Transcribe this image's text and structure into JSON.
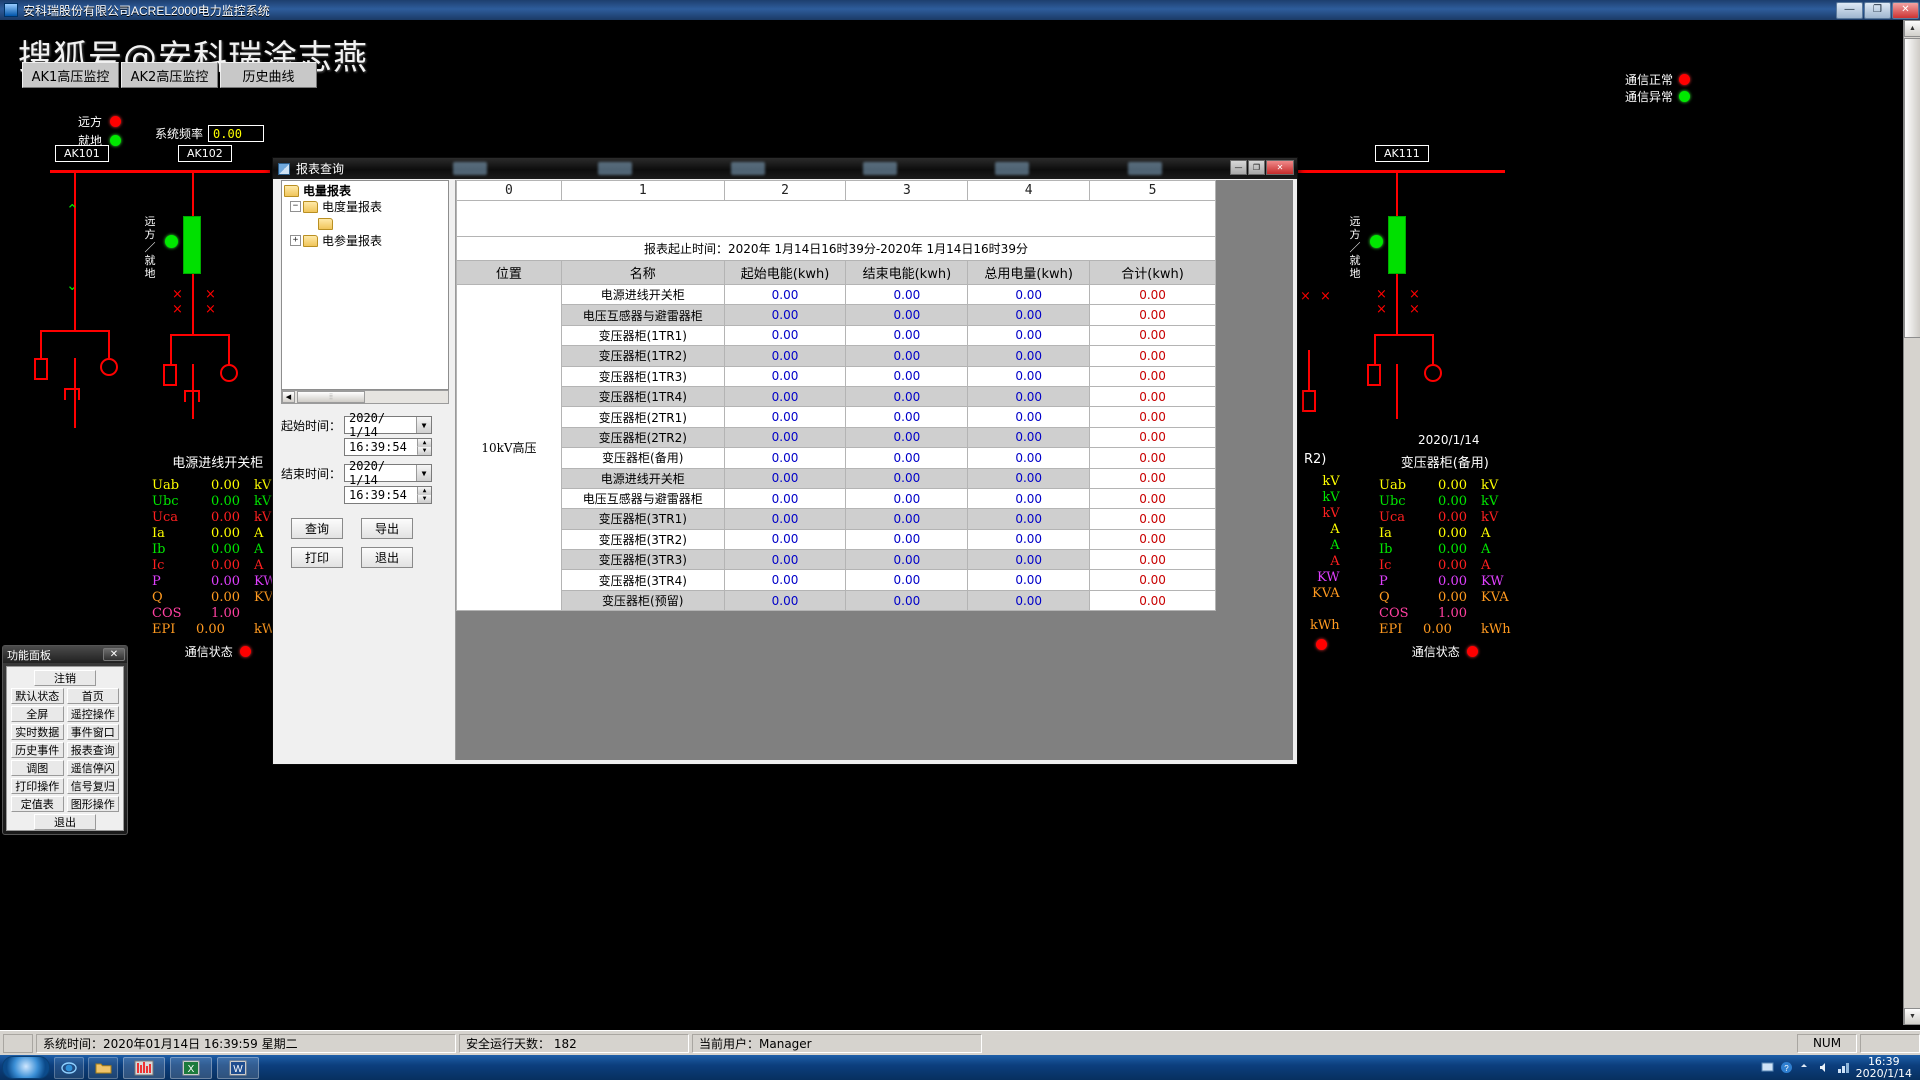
{
  "os": {
    "title": "安科瑞股份有限公司ACREL2000电力监控系统",
    "min": "—",
    "max": "❐",
    "close": "✕"
  },
  "watermark": "搜狐号@安科瑞涂志燕",
  "nav": [
    {
      "label": "AK1高压监控"
    },
    {
      "label": "AK2高压监控"
    },
    {
      "label": "历史曲线"
    }
  ],
  "comm_top": [
    {
      "label": "通信正常",
      "color": "#ff0000"
    },
    {
      "label": "通信异常",
      "color": "#00e800"
    }
  ],
  "remote_local": [
    {
      "label": "远方",
      "color": "#ff0000"
    },
    {
      "label": "就地",
      "color": "#00e800"
    }
  ],
  "frequency": {
    "label": "系统频率",
    "value": "0.00"
  },
  "bus_labels": {
    "ak101": "AK101",
    "ak102": "AK102",
    "ak111": "AK111"
  },
  "diagram_side_text": {
    "left": "远方／就地",
    "right": "远方／就地"
  },
  "panel_left": {
    "title": "电源进线开关柜",
    "rows": [
      {
        "name": "Uab",
        "value": "0.00",
        "unit": "kV",
        "color": "#ffff00"
      },
      {
        "name": "Ubc",
        "value": "0.00",
        "unit": "kV",
        "color": "#00e800"
      },
      {
        "name": "Uca",
        "value": "0.00",
        "unit": "kV",
        "color": "#ff2020"
      },
      {
        "name": "Ia",
        "value": "0.00",
        "unit": "A",
        "color": "#ffff00"
      },
      {
        "name": "Ib",
        "value": "0.00",
        "unit": "A",
        "color": "#00e800"
      },
      {
        "name": "Ic",
        "value": "0.00",
        "unit": "A",
        "color": "#ff2020"
      },
      {
        "name": "P",
        "value": "0.00",
        "unit": "KW",
        "color": "#e040ff"
      },
      {
        "name": "Q",
        "value": "0.00",
        "unit": "KVA",
        "color": "#ff9a20"
      },
      {
        "name": "COS",
        "value": "1.00",
        "unit": "",
        "color": "#ff40a0"
      },
      {
        "name": "EPI",
        "value": "0.00",
        "unit": "kWh",
        "color": "#ff9a20"
      }
    ],
    "comm_label": "通信状态"
  },
  "panel_right_partial": {
    "title": "R2)",
    "units": [
      "kV",
      "kV",
      "kV",
      "A",
      "A",
      "A",
      "KW",
      "KVA",
      "",
      "kWh"
    ],
    "colors": [
      "#ffff00",
      "#00e800",
      "#ff2020",
      "#ffff00",
      "#00e800",
      "#ff2020",
      "#e040ff",
      "#ff9a20",
      "#ff40a0",
      "#ff9a20"
    ]
  },
  "panel_right": {
    "title": "变压器柜(备用)",
    "rows": [
      {
        "name": "Uab",
        "value": "0.00",
        "unit": "kV",
        "color": "#ffff00"
      },
      {
        "name": "Ubc",
        "value": "0.00",
        "unit": "kV",
        "color": "#00e800"
      },
      {
        "name": "Uca",
        "value": "0.00",
        "unit": "kV",
        "color": "#ff2020"
      },
      {
        "name": "Ia",
        "value": "0.00",
        "unit": "A",
        "color": "#ffff00"
      },
      {
        "name": "Ib",
        "value": "0.00",
        "unit": "A",
        "color": "#00e800"
      },
      {
        "name": "Ic",
        "value": "0.00",
        "unit": "A",
        "color": "#ff2020"
      },
      {
        "name": "P",
        "value": "0.00",
        "unit": "KW",
        "color": "#e040ff"
      },
      {
        "name": "Q",
        "value": "0.00",
        "unit": "KVA",
        "color": "#ff9a20"
      },
      {
        "name": "COS",
        "value": "1.00",
        "unit": "",
        "color": "#ff40a0"
      },
      {
        "name": "EPI",
        "value": "0.00",
        "unit": "kWh",
        "color": "#ff9a20"
      }
    ],
    "comm_label": "通信状态",
    "date_stamp": "2020/1/14"
  },
  "func_panel": {
    "title": "功能面板",
    "close": "✕",
    "logout": "注销",
    "buttons": [
      [
        "默认状态",
        "首页"
      ],
      [
        "全屏",
        "遥控操作"
      ],
      [
        "实时数据",
        "事件窗口"
      ],
      [
        "历史事件",
        "报表查询"
      ],
      [
        "调图",
        "遥信停闪"
      ],
      [
        "打印操作",
        "信号复归"
      ],
      [
        "定值表",
        "图形操作"
      ]
    ],
    "exit": "退出"
  },
  "report": {
    "title": "报表查询",
    "min": "—",
    "max": "❐",
    "close": "✕",
    "tree": {
      "root": "电量报表",
      "children": [
        {
          "label": "电度量报表",
          "toggle": "−"
        },
        {
          "label": "",
          "toggle": ""
        },
        {
          "label": "电参量报表",
          "toggle": "+"
        }
      ]
    },
    "form": {
      "start_label": "起始时间：",
      "start_date": "2020/ 1/14",
      "start_time": "16:39:54",
      "end_label": "结束时间：",
      "end_date": "2020/ 1/14",
      "end_time": "16:39:54",
      "buttons": [
        "查询",
        "导出",
        "打印",
        "退出"
      ]
    },
    "column_index": [
      "0",
      "1",
      "2",
      "3",
      "4",
      "5"
    ],
    "time_range": "报表起止时间：2020年 1月14日16时39分-2020年 1月14日16时39分",
    "headers": [
      "位置",
      "名称",
      "起始电能(kwh)",
      "结束电能(kwh)",
      "总用电量(kwh)",
      "合计(kwh)"
    ],
    "position": "10kV高压",
    "rows": [
      {
        "name": "电源进线开关柜",
        "start": "0.00",
        "end": "0.00",
        "total": "0.00",
        "sum": "0.00"
      },
      {
        "name": "电压互感器与避雷器柜",
        "start": "0.00",
        "end": "0.00",
        "total": "0.00",
        "sum": "0.00"
      },
      {
        "name": "变压器柜(1TR1)",
        "start": "0.00",
        "end": "0.00",
        "total": "0.00",
        "sum": "0.00"
      },
      {
        "name": "变压器柜(1TR2)",
        "start": "0.00",
        "end": "0.00",
        "total": "0.00",
        "sum": "0.00"
      },
      {
        "name": "变压器柜(1TR3)",
        "start": "0.00",
        "end": "0.00",
        "total": "0.00",
        "sum": "0.00"
      },
      {
        "name": "变压器柜(1TR4)",
        "start": "0.00",
        "end": "0.00",
        "total": "0.00",
        "sum": "0.00"
      },
      {
        "name": "变压器柜(2TR1)",
        "start": "0.00",
        "end": "0.00",
        "total": "0.00",
        "sum": "0.00"
      },
      {
        "name": "变压器柜(2TR2)",
        "start": "0.00",
        "end": "0.00",
        "total": "0.00",
        "sum": "0.00"
      },
      {
        "name": "变压器柜(备用)",
        "start": "0.00",
        "end": "0.00",
        "total": "0.00",
        "sum": "0.00"
      },
      {
        "name": "电源进线开关柜",
        "start": "0.00",
        "end": "0.00",
        "total": "0.00",
        "sum": "0.00"
      },
      {
        "name": "电压互感器与避雷器柜",
        "start": "0.00",
        "end": "0.00",
        "total": "0.00",
        "sum": "0.00"
      },
      {
        "name": "变压器柜(3TR1)",
        "start": "0.00",
        "end": "0.00",
        "total": "0.00",
        "sum": "0.00"
      },
      {
        "name": "变压器柜(3TR2)",
        "start": "0.00",
        "end": "0.00",
        "total": "0.00",
        "sum": "0.00"
      },
      {
        "name": "变压器柜(3TR3)",
        "start": "0.00",
        "end": "0.00",
        "total": "0.00",
        "sum": "0.00"
      },
      {
        "name": "变压器柜(3TR4)",
        "start": "0.00",
        "end": "0.00",
        "total": "0.00",
        "sum": "0.00"
      },
      {
        "name": "变压器柜(预留)",
        "start": "0.00",
        "end": "0.00",
        "total": "0.00",
        "sum": "0.00"
      }
    ]
  },
  "statusbar": {
    "system_time": "系统时间：2020年01月14日  16:39:59  星期二",
    "safe_days": "安全运行天数： 182",
    "current_user": "当前用户：Manager",
    "num": "NUM"
  },
  "taskbar": {
    "clock_time": "16:39",
    "clock_date": "2020/1/14"
  }
}
